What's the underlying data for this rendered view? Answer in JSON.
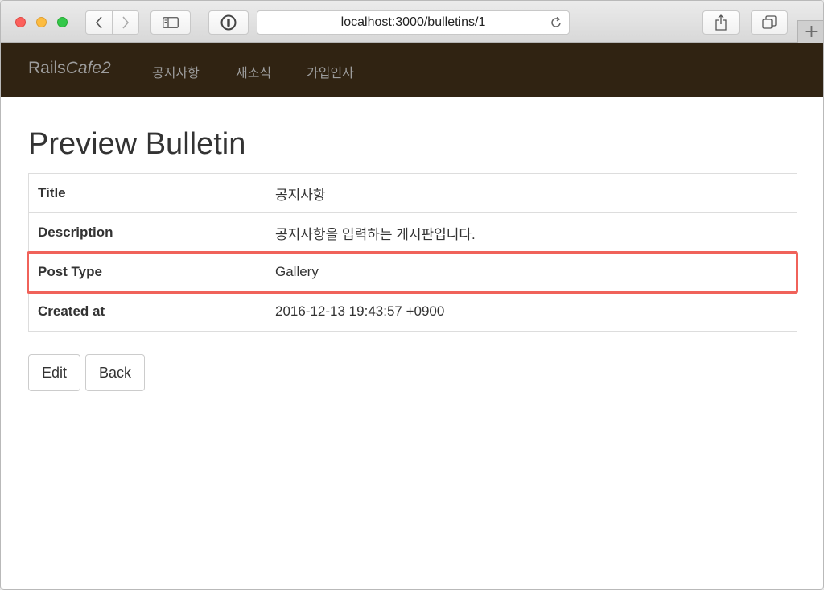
{
  "browser": {
    "url": "localhost:3000/bulletins/1",
    "new_tab_glyph": "+"
  },
  "navbar": {
    "brand_regular": "Rails",
    "brand_italic": "Cafe2",
    "links": [
      {
        "label": "공지사항"
      },
      {
        "label": "새소식"
      },
      {
        "label": "가입인사"
      }
    ]
  },
  "page": {
    "title": "Preview Bulletin",
    "rows": [
      {
        "key": "Title",
        "value": "공지사항"
      },
      {
        "key": "Description",
        "value": "공지사항을 입력하는 게시판입니다."
      },
      {
        "key": "Post Type",
        "value": "Gallery"
      },
      {
        "key": "Created at",
        "value": "2016-12-13 19:43:57 +0900"
      }
    ],
    "highlighted_row": "Post Type",
    "actions": {
      "edit_label": "Edit",
      "back_label": "Back"
    }
  },
  "colors": {
    "navbar_bg": "#302312",
    "highlight": "#f0625a"
  }
}
